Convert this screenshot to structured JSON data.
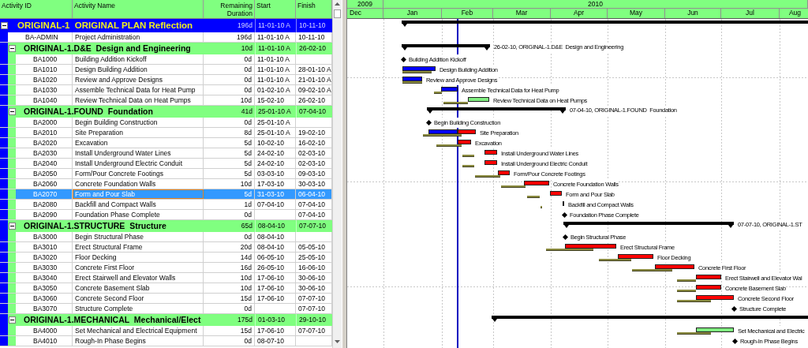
{
  "columns": [
    {
      "label": "Activity ID"
    },
    {
      "label": "Activity Name"
    },
    {
      "label": "Remaining Duration"
    },
    {
      "label": "Start"
    },
    {
      "label": "Finish"
    }
  ],
  "timescale": {
    "years": [
      "2009",
      "2010"
    ],
    "months": [
      "Dec",
      "Jan",
      "Feb",
      "Mar",
      "Apr",
      "May",
      "Jun",
      "Jul",
      "Aug"
    ]
  },
  "rows": [
    {
      "kind": "project",
      "title": "ORIGINAL-1  ORIGINAL PLAN Reflection",
      "duration": "196d",
      "start": "11-01-10 A",
      "finish": "10-11-10",
      "expanded": true,
      "selected": false,
      "bar": {
        "kind": "summary"
      },
      "children": [
        {
          "kind": "task",
          "id": "BA-ADMIN",
          "name": "Project Administration",
          "duration": "196d",
          "start": "11-01-10 A",
          "finish": "10-11-10",
          "selected": false
        },
        {
          "kind": "group",
          "title": "ORIGINAL-1.D&E  Design and Engineering",
          "duration": "10d",
          "start": "11-01-10 A",
          "finish": "26-02-10",
          "expanded": true,
          "selected": false,
          "bar": {
            "kind": "summary",
            "label": "26-02-10, ORIGINAL-1.D&E  Design and Engineering"
          },
          "children": [
            {
              "kind": "task",
              "id": "BA1000",
              "name": "Building Addition Kickoff",
              "duration": "0d",
              "start": "11-01-10 A",
              "selected": false,
              "bar": {
                "kind": "milestone",
                "label": "Building Addition Kickoff"
              }
            },
            {
              "kind": "task",
              "id": "BA1010",
              "name": "Design Building Addition",
              "duration": "0d",
              "start": "11-01-10 A",
              "finish": "28-01-10 A",
              "selected": false,
              "bar": {
                "kind": "task",
                "label": "Design Building Addition"
              }
            },
            {
              "kind": "task",
              "id": "BA1020",
              "name": "Review and Approve Designs",
              "duration": "0d",
              "start": "11-01-10 A",
              "finish": "21-01-10 A",
              "selected": false,
              "bar": {
                "kind": "task",
                "label": "Review and Approve Designs"
              }
            },
            {
              "kind": "task",
              "id": "BA1030",
              "name": "Assemble Technical Data for Heat Pump",
              "duration": "0d",
              "start": "01-02-10 A",
              "finish": "09-02-10 A",
              "selected": false,
              "bar": {
                "kind": "task",
                "label": "Assemble Technical Data for Heat Pump"
              }
            },
            {
              "kind": "task",
              "id": "BA1040",
              "name": "Review Technical Data on Heat Pumps",
              "duration": "10d",
              "start": "15-02-10",
              "finish": "26-02-10",
              "selected": false,
              "bar": {
                "kind": "task",
                "critical": false,
                "label": "Review Technical Data on Heat Pumps"
              }
            }
          ]
        },
        {
          "kind": "group",
          "title": "ORIGINAL-1.FOUND  Foundation",
          "duration": "41d",
          "start": "25-01-10 A",
          "finish": "07-04-10",
          "expanded": true,
          "selected": false,
          "bar": {
            "kind": "summary",
            "label": "07-04-10, ORIGINAL-1.FOUND  Foundation"
          },
          "children": [
            {
              "kind": "task",
              "id": "BA2000",
              "name": "Begin Building Construction",
              "duration": "0d",
              "start": "25-01-10 A",
              "selected": false,
              "bar": {
                "kind": "milestone",
                "label": "Begin Building Construction"
              }
            },
            {
              "kind": "task",
              "id": "BA2010",
              "name": "Site Preparation",
              "duration": "8d",
              "start": "25-01-10 A",
              "finish": "19-02-10",
              "selected": false,
              "bar": {
                "kind": "task",
                "critical": true,
                "label": "Site Preparation"
              }
            },
            {
              "kind": "task",
              "id": "BA2020",
              "name": "Excavation",
              "duration": "5d",
              "start": "10-02-10",
              "finish": "16-02-10",
              "selected": false,
              "bar": {
                "kind": "task",
                "critical": true,
                "label": "Excavation"
              }
            },
            {
              "kind": "task",
              "id": "BA2030",
              "name": "Install Underground Water Lines",
              "duration": "5d",
              "start": "24-02-10",
              "finish": "02-03-10",
              "selected": false,
              "bar": {
                "kind": "task",
                "critical": true,
                "label": "Install Underground Water Lines"
              }
            },
            {
              "kind": "task",
              "id": "BA2040",
              "name": "Install Underground Electric Conduit",
              "duration": "5d",
              "start": "24-02-10",
              "finish": "02-03-10",
              "selected": false,
              "bar": {
                "kind": "task",
                "critical": true,
                "label": "Install Underground Electric Conduit"
              }
            },
            {
              "kind": "task",
              "id": "BA2050",
              "name": "Form/Pour Concrete Footings",
              "duration": "5d",
              "start": "03-03-10",
              "finish": "09-03-10",
              "selected": false,
              "bar": {
                "kind": "task",
                "critical": true,
                "label": "Form/Pour Concrete Footings"
              }
            },
            {
              "kind": "task",
              "id": "BA2060",
              "name": "Concrete Foundation Walls",
              "duration": "10d",
              "start": "17-03-10",
              "finish": "30-03-10",
              "selected": false,
              "bar": {
                "kind": "task",
                "critical": true,
                "label": "Concrete Foundation Walls"
              }
            },
            {
              "kind": "task",
              "id": "BA2070",
              "name": "Form and Pour Slab",
              "duration": "5d",
              "start": "31-03-10",
              "finish": "06-04-10",
              "selected": true,
              "bar": {
                "kind": "task",
                "critical": true,
                "label": "Form and Pour Slab"
              }
            },
            {
              "kind": "task",
              "id": "BA2080",
              "name": "Backfill and Compact Walls",
              "duration": "1d",
              "start": "07-04-10",
              "finish": "07-04-10",
              "selected": false,
              "bar": {
                "kind": "task",
                "critical": true,
                "label": "Backfill and Compact Walls"
              }
            },
            {
              "kind": "task",
              "id": "BA2090",
              "name": "Foundation Phase Complete",
              "duration": "0d",
              "finish": "07-04-10",
              "selected": false,
              "bar": {
                "kind": "milestone",
                "label": "Foundation Phase Complete"
              }
            }
          ]
        },
        {
          "kind": "group",
          "title": "ORIGINAL-1.STRUCTURE  Structure",
          "duration": "65d",
          "start": "08-04-10",
          "finish": "07-07-10",
          "expanded": true,
          "selected": false,
          "bar": {
            "kind": "summary",
            "label": "07-07-10, ORIGINAL-1.ST"
          },
          "children": [
            {
              "kind": "task",
              "id": "BA3000",
              "name": "Begin Structural Phase",
              "duration": "0d",
              "start": "08-04-10",
              "selected": false,
              "bar": {
                "kind": "milestone",
                "label": "Begin Structural Phase"
              }
            },
            {
              "kind": "task",
              "id": "BA3010",
              "name": "Erect Structural Frame",
              "duration": "20d",
              "start": "08-04-10",
              "finish": "05-05-10",
              "selected": false,
              "bar": {
                "kind": "task",
                "critical": true,
                "label": "Erect Structural Frame"
              }
            },
            {
              "kind": "task",
              "id": "BA3020",
              "name": "Floor Decking",
              "duration": "14d",
              "start": "06-05-10",
              "finish": "25-05-10",
              "selected": false,
              "bar": {
                "kind": "task",
                "critical": true,
                "label": "Floor Decking"
              }
            },
            {
              "kind": "task",
              "id": "BA3030",
              "name": "Concrete First Floor",
              "duration": "16d",
              "start": "26-05-10",
              "finish": "16-06-10",
              "selected": false,
              "bar": {
                "kind": "task",
                "critical": true,
                "label": "Concrete First Floor"
              }
            },
            {
              "kind": "task",
              "id": "BA3040",
              "name": "Erect Stairwell and Elevator Walls",
              "duration": "10d",
              "start": "17-06-10",
              "finish": "30-06-10",
              "selected": false,
              "bar": {
                "kind": "task",
                "critical": true,
                "label": "Erect Stairwell and Elevator Wal"
              }
            },
            {
              "kind": "task",
              "id": "BA3050",
              "name": "Concrete Basement Slab",
              "duration": "10d",
              "start": "17-06-10",
              "finish": "30-06-10",
              "selected": false,
              "bar": {
                "kind": "task",
                "critical": true,
                "label": "Concrete Basement Slab"
              }
            },
            {
              "kind": "task",
              "id": "BA3060",
              "name": "Concrete Second Floor",
              "duration": "15d",
              "start": "17-06-10",
              "finish": "07-07-10",
              "selected": false,
              "bar": {
                "kind": "task",
                "critical": true,
                "label": "Concrete Second Floor"
              }
            },
            {
              "kind": "task",
              "id": "BA3070",
              "name": "Structure Complete",
              "duration": "0d",
              "finish": "07-07-10",
              "selected": false,
              "bar": {
                "kind": "milestone",
                "label": "Structure Complete"
              }
            }
          ]
        },
        {
          "kind": "group",
          "title": "ORIGINAL-1.MECHANICAL  Mechanical/Elect",
          "duration": "175d",
          "start": "01-03-10",
          "finish": "29-10-10",
          "expanded": true,
          "selected": false,
          "bar": {
            "kind": "summary"
          },
          "children": [
            {
              "kind": "task",
              "id": "BA4000",
              "name": "Set Mechanical and Electrical Equipment",
              "duration": "15d",
              "start": "17-06-10",
              "finish": "07-07-10",
              "selected": false,
              "bar": {
                "kind": "task",
                "critical": false,
                "label": "Set Mechanical and Electric"
              }
            },
            {
              "kind": "task",
              "id": "BA4010",
              "name": "Rough-In Phase Begins",
              "duration": "0d",
              "start": "08-07-10",
              "selected": false,
              "bar": {
                "kind": "milestone",
                "label": "Rough-In Phase Begins"
              }
            }
          ]
        }
      ]
    }
  ]
}
